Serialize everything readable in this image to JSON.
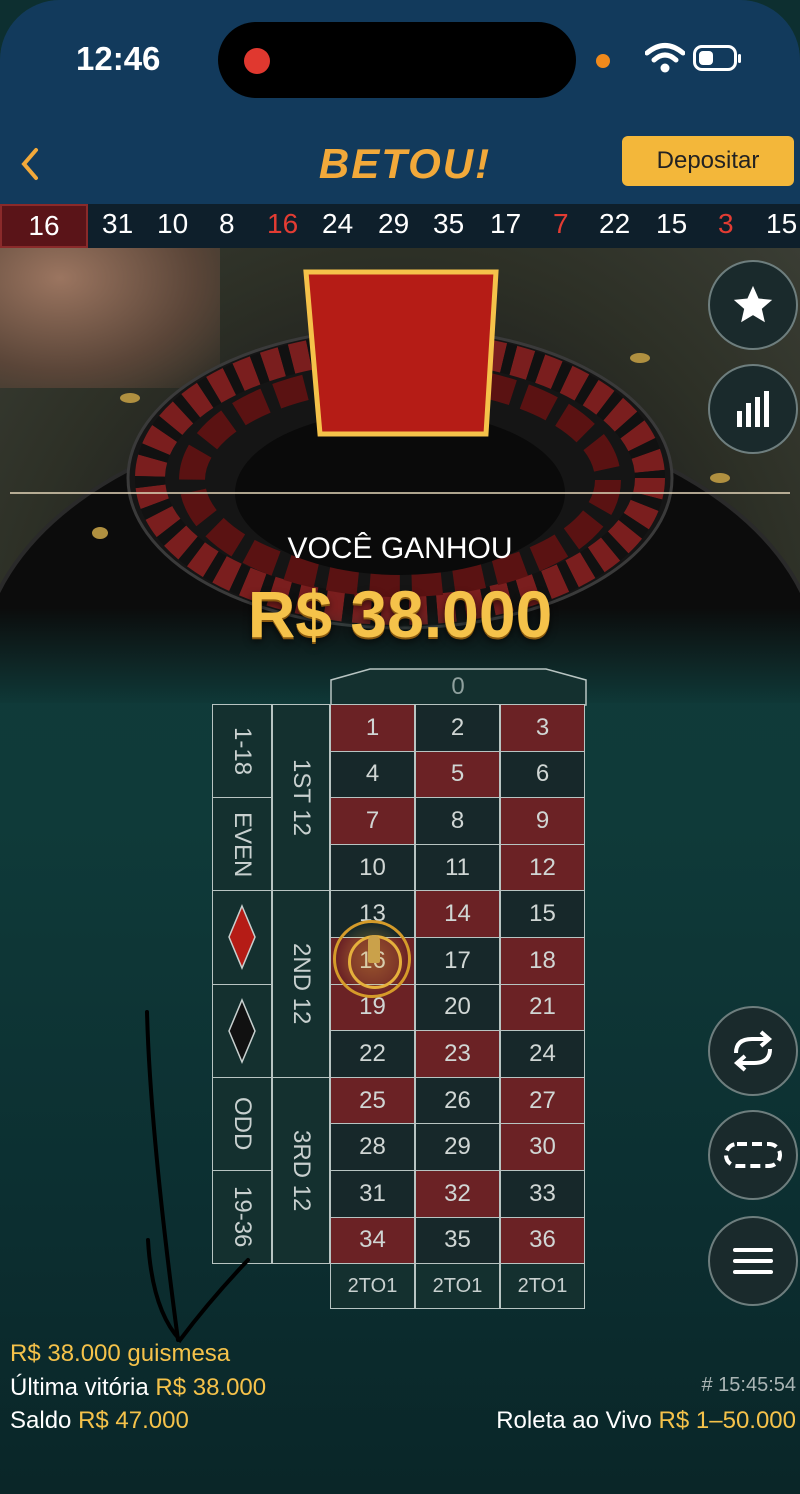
{
  "status_bar": {
    "time": "12:46"
  },
  "header": {
    "logo": "BETOU!",
    "deposit_label": "Depositar"
  },
  "history": {
    "first": "16",
    "numbers": [
      {
        "value": "31",
        "color": "white"
      },
      {
        "value": "10",
        "color": "white"
      },
      {
        "value": "8",
        "color": "white"
      },
      {
        "value": "16",
        "color": "red"
      },
      {
        "value": "24",
        "color": "white"
      },
      {
        "value": "29",
        "color": "white"
      },
      {
        "value": "35",
        "color": "white"
      },
      {
        "value": "17",
        "color": "white"
      },
      {
        "value": "7",
        "color": "red"
      },
      {
        "value": "22",
        "color": "white"
      },
      {
        "value": "15",
        "color": "white"
      },
      {
        "value": "3",
        "color": "red"
      },
      {
        "value": "15",
        "color": "white"
      }
    ]
  },
  "result": {
    "label": "VOCÊ GANHOU",
    "amount": "R$ 38.000"
  },
  "table": {
    "zero": "0",
    "rows": [
      [
        "1",
        "2",
        "3"
      ],
      [
        "4",
        "5",
        "6"
      ],
      [
        "7",
        "8",
        "9"
      ],
      [
        "10",
        "11",
        "12"
      ],
      [
        "13",
        "14",
        "15"
      ],
      [
        "16",
        "17",
        "18"
      ],
      [
        "19",
        "20",
        "21"
      ],
      [
        "22",
        "23",
        "24"
      ],
      [
        "25",
        "26",
        "27"
      ],
      [
        "28",
        "29",
        "30"
      ],
      [
        "31",
        "32",
        "33"
      ],
      [
        "34",
        "35",
        "36"
      ]
    ],
    "red_numbers": [
      "1",
      "3",
      "5",
      "7",
      "9",
      "12",
      "14",
      "16",
      "18",
      "19",
      "21",
      "23",
      "25",
      "27",
      "30",
      "32",
      "34",
      "36"
    ],
    "outside": {
      "low": "1-18",
      "even": "EVEN",
      "odd": "ODD",
      "high": "19-36"
    },
    "dozens": {
      "first": "1ST 12",
      "second": "2ND 12",
      "third": "3RD 12"
    },
    "columns": [
      "2TO1",
      "2TO1",
      "2TO1"
    ],
    "chip_on": "16"
  },
  "side_buttons": [
    "star-icon",
    "stats-icon",
    "repeat-icon",
    "racetrack-icon",
    "menu-icon"
  ],
  "footer": {
    "win_line": "R$ 38.000 guismesa",
    "last_win_label": "Última vitória",
    "last_win_value": "R$ 38.000",
    "balance_label": "Saldo",
    "balance_value": "R$ 47.000",
    "round_id": "# 15:45:54",
    "game_name": "Roleta ao Vivo",
    "limits": "R$ 1–50.000"
  },
  "colors": {
    "gold": "#f5c24a",
    "header": "#123a5c",
    "red_cell": "#6b2225",
    "black_cell": "#17282a"
  }
}
